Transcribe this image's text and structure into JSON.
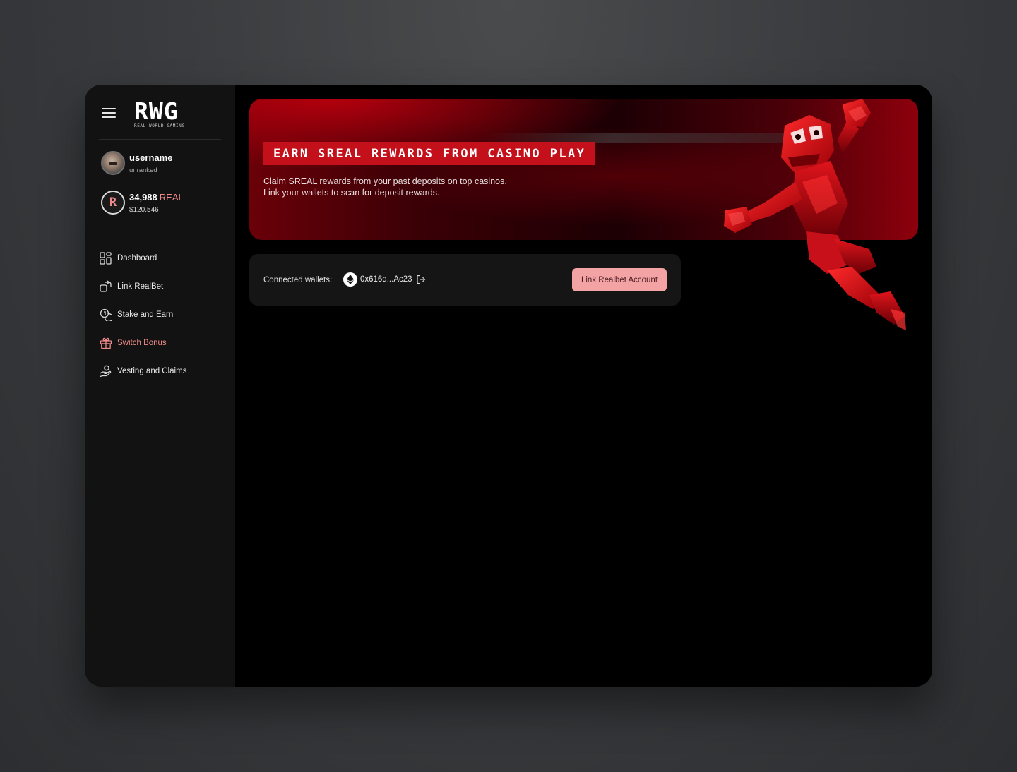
{
  "brand": {
    "logo": "RWG",
    "tagline": "REAL WORLD GAMING"
  },
  "profile": {
    "username": "username",
    "rank": "unranked"
  },
  "balance": {
    "amount": "34,988",
    "unit": "REAL",
    "usd": "$120.546",
    "token_glyph": "R"
  },
  "nav": {
    "items": [
      {
        "label": "Dashboard",
        "icon": "dashboard-icon"
      },
      {
        "label": "Link RealBet",
        "icon": "link-icon"
      },
      {
        "label": "Stake and Earn",
        "icon": "coins-icon"
      },
      {
        "label": "Switch Bonus",
        "icon": "gift-icon",
        "active": true
      },
      {
        "label": "Vesting and Claims",
        "icon": "hand-coin-icon"
      }
    ]
  },
  "hero": {
    "title": "EARN SREAL REWARDS FROM CASINO PLAY",
    "desc_line1": "Claim SREAL rewards from your past deposits on top casinos.",
    "desc_line2": "Link your wallets to scan for deposit rewards."
  },
  "wallets": {
    "label": "Connected wallets:",
    "address": "0x616d...Ac23",
    "button_label": "Link Realbet Account"
  },
  "colors": {
    "accent": "#f0898a",
    "hero_red": "#c3101a",
    "button_bg": "#f4a3a5",
    "sidebar_bg": "#121212"
  }
}
